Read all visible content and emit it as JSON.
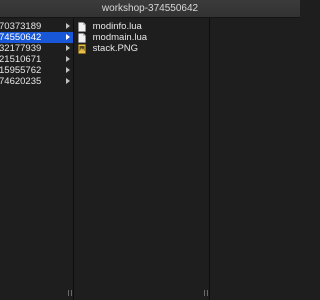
{
  "window": {
    "title": "workshop-374550642"
  },
  "column1": {
    "items": [
      {
        "label": "70373189",
        "selected": false
      },
      {
        "label": "74550642",
        "selected": true
      },
      {
        "label": "32177939",
        "selected": false
      },
      {
        "label": "21510671",
        "selected": false
      },
      {
        "label": "15955762",
        "selected": false
      },
      {
        "label": "74620235",
        "selected": false
      }
    ]
  },
  "column2": {
    "items": [
      {
        "label": "modinfo.lua",
        "icon": "lua-file-icon"
      },
      {
        "label": "modmain.lua",
        "icon": "lua-file-icon"
      },
      {
        "label": "stack.PNG",
        "icon": "png-image-icon"
      }
    ]
  },
  "colors": {
    "selection": "#1858d8",
    "background": "#1e1e1e",
    "text": "#e6e6e6"
  }
}
